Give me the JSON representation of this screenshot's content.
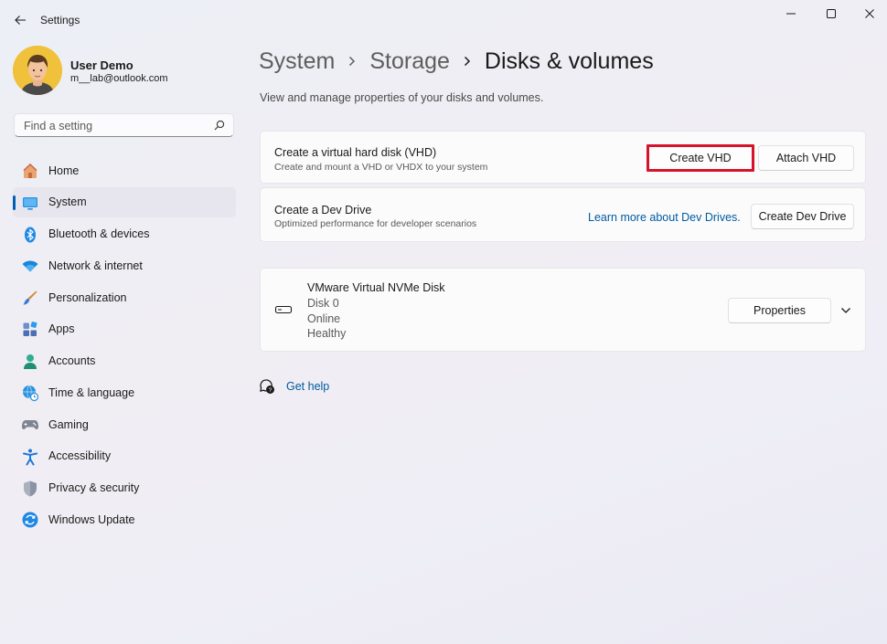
{
  "window": {
    "title": "Settings"
  },
  "profile": {
    "name": "User Demo",
    "email": "m__lab@outlook.com"
  },
  "search": {
    "placeholder": "Find a setting",
    "value": ""
  },
  "sidebar": {
    "items": [
      {
        "label": "Home",
        "icon": "home-icon"
      },
      {
        "label": "System",
        "icon": "system-icon",
        "active": true
      },
      {
        "label": "Bluetooth & devices",
        "icon": "bluetooth-icon"
      },
      {
        "label": "Network & internet",
        "icon": "network-icon"
      },
      {
        "label": "Personalization",
        "icon": "personalization-icon"
      },
      {
        "label": "Apps",
        "icon": "apps-icon"
      },
      {
        "label": "Accounts",
        "icon": "accounts-icon"
      },
      {
        "label": "Time & language",
        "icon": "time-language-icon"
      },
      {
        "label": "Gaming",
        "icon": "gaming-icon"
      },
      {
        "label": "Accessibility",
        "icon": "accessibility-icon"
      },
      {
        "label": "Privacy & security",
        "icon": "shield-icon"
      },
      {
        "label": "Windows Update",
        "icon": "windows-update-icon"
      }
    ]
  },
  "breadcrumb": [
    "System",
    "Storage",
    "Disks & volumes"
  ],
  "page": {
    "description": "View and manage properties of your disks and volumes."
  },
  "vhd_card": {
    "title": "Create a virtual hard disk (VHD)",
    "subtitle": "Create and mount a VHD or VHDX to your system",
    "create_label": "Create VHD",
    "attach_label": "Attach VHD"
  },
  "devdrive_card": {
    "title": "Create a Dev Drive",
    "subtitle": "Optimized performance for developer scenarios",
    "learn_more": "Learn more about Dev Drives.",
    "create_label": "Create Dev Drive"
  },
  "disk": {
    "name": "VMware Virtual NVMe Disk",
    "number": "Disk 0",
    "status": "Online",
    "health": "Healthy",
    "properties_label": "Properties"
  },
  "help": {
    "label": "Get help"
  },
  "colors": {
    "accent": "#005fb8",
    "link": "#005a9e",
    "highlight": "#d6132b"
  }
}
